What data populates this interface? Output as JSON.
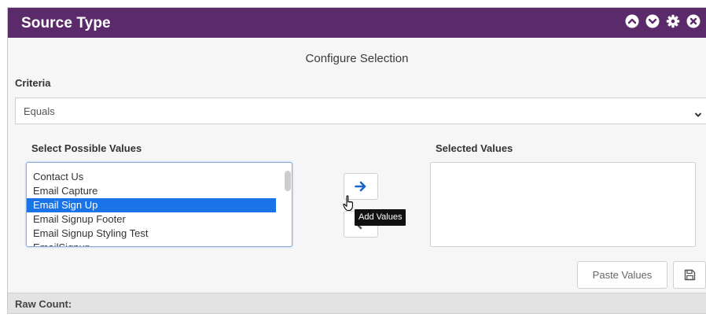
{
  "window": {
    "title": "Source Type",
    "titlebar_color": "#5b2a6b",
    "icons": [
      "chevron-up-icon",
      "chevron-down-icon",
      "gear-icon",
      "close-icon"
    ]
  },
  "section": {
    "subtitle": "Configure Selection"
  },
  "criteria": {
    "label": "Criteria",
    "value": "Equals"
  },
  "possible": {
    "label": "Select Possible Values",
    "items": [
      {
        "label": "Contact Us"
      },
      {
        "label": "Email Capture"
      },
      {
        "label": "Email Sign Up",
        "selected": true
      },
      {
        "label": "Email Signup Footer"
      },
      {
        "label": "Email Signup Styling Test"
      },
      {
        "label": "EmailSignup"
      }
    ],
    "selection_color": "#1a74e8"
  },
  "selected": {
    "label": "Selected Values"
  },
  "actions": {
    "add_tooltip": "Add Values",
    "paste_label": "Paste Values",
    "accent": "#1a64c8"
  },
  "footer": {
    "raw_count_label": "Raw Count:"
  }
}
